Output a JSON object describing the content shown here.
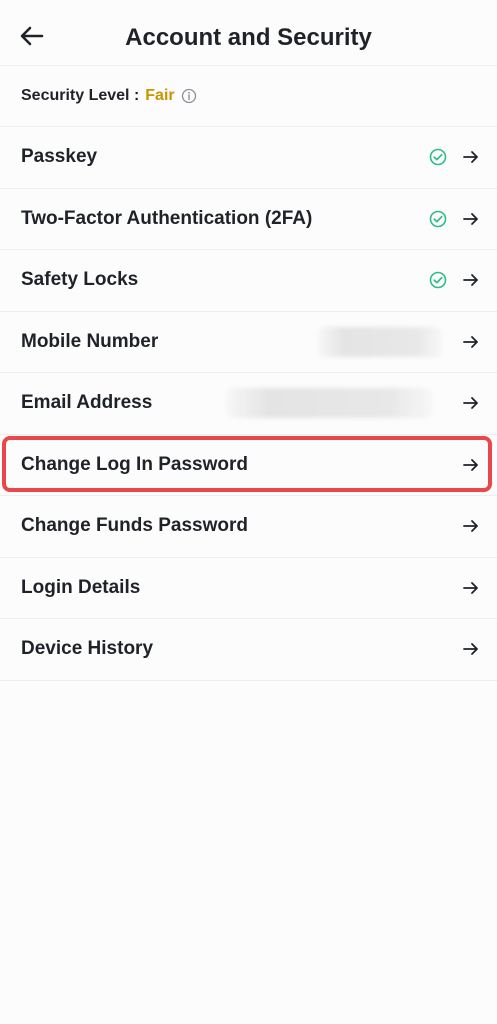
{
  "header": {
    "title": "Account and Security"
  },
  "security_level": {
    "label": "Security Level :",
    "value": "Fair"
  },
  "colors": {
    "accent_gold": "#c99400",
    "check_green": "#2ebd85",
    "highlight_red": "#e8474b"
  },
  "items": [
    {
      "label": "Passkey",
      "verified": true
    },
    {
      "label": "Two-Factor Authentication (2FA)",
      "verified": true
    },
    {
      "label": "Safety Locks",
      "verified": true
    },
    {
      "label": "Mobile Number",
      "verified": false,
      "value_hidden": true
    },
    {
      "label": "Email Address",
      "verified": false,
      "value_hidden": true
    },
    {
      "label": "Change Log In Password",
      "verified": false,
      "highlighted": true
    },
    {
      "label": "Change Funds Password",
      "verified": false
    },
    {
      "label": "Login Details",
      "verified": false
    },
    {
      "label": "Device History",
      "verified": false
    }
  ]
}
